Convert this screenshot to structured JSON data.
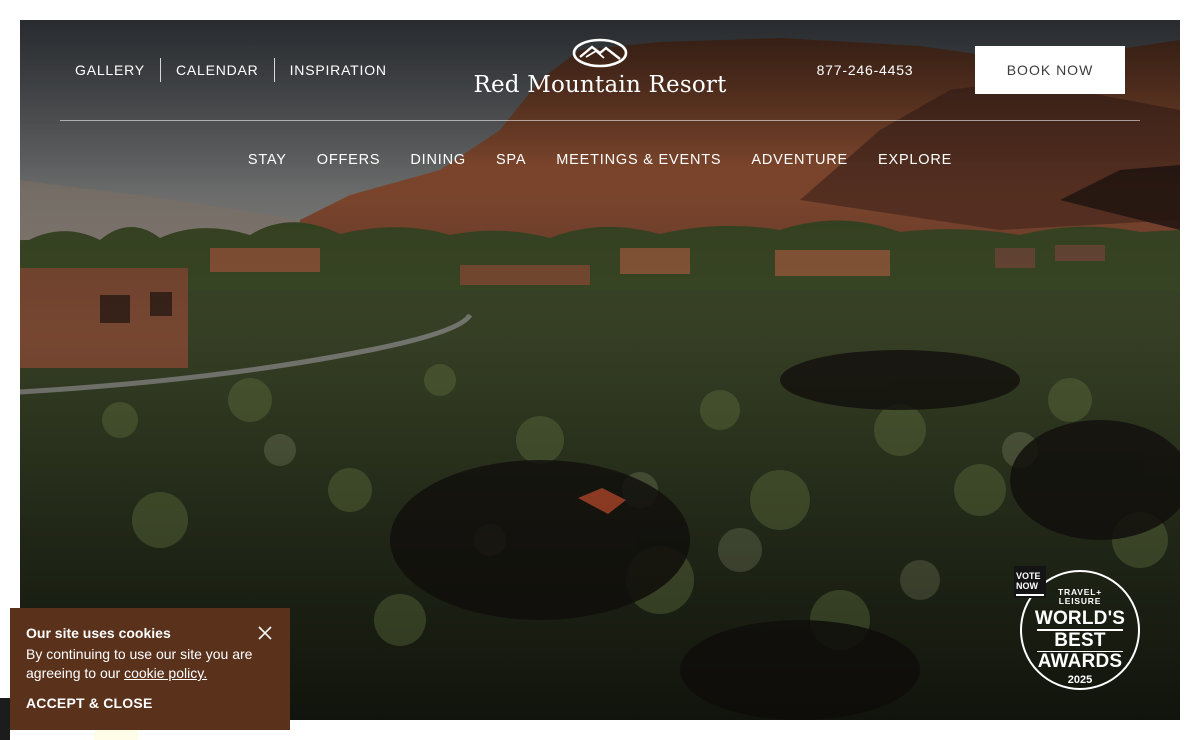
{
  "header": {
    "utility_links": [
      {
        "label": "GALLERY"
      },
      {
        "label": "CALENDAR"
      },
      {
        "label": "INSPIRATION"
      }
    ],
    "brand": {
      "name": "Red Mountain Resort",
      "icon": "mountain-logo-icon"
    },
    "phone": "877-246-4453",
    "book_label": "BOOK NOW"
  },
  "main_nav": [
    {
      "label": "STAY"
    },
    {
      "label": "OFFERS"
    },
    {
      "label": "DINING"
    },
    {
      "label": "SPA"
    },
    {
      "label": "MEETINGS & EVENTS"
    },
    {
      "label": "ADVENTURE"
    },
    {
      "label": "EXPLORE"
    }
  ],
  "hero": {
    "image": "desert-resort-landscape"
  },
  "award": {
    "vote_line1": "VOTE",
    "vote_line2": "NOW",
    "brand_line1": "TRAVEL+",
    "brand_line2": "LEISURE",
    "line1": "WORLD'S",
    "line2": "BEST",
    "line3": "AWARDS",
    "year": "2025"
  },
  "cookie": {
    "title": "Our site uses cookies",
    "text": "By continuing to use our site you are agreeing to our",
    "link": "cookie policy.",
    "accept": "ACCEPT & CLOSE",
    "close_icon": "close-icon"
  },
  "colors": {
    "cookie_bg": "#5a321c",
    "button_bg": "#ffffff",
    "text": "#ffffff"
  }
}
